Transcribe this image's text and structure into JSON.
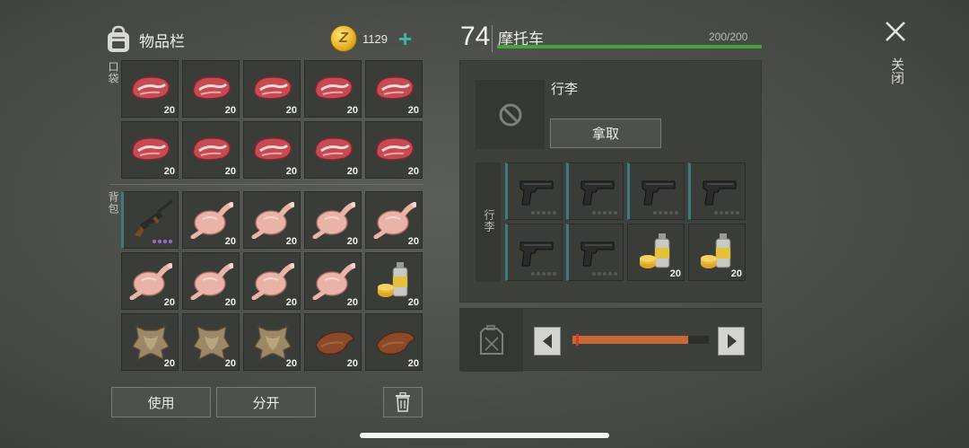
{
  "inventory": {
    "title": "物品栏",
    "coins": "1129",
    "pocket_label": "口袋",
    "backpack_label": "背包",
    "pocket_slots": [
      {
        "item": "raw-meat",
        "qty": "20"
      },
      {
        "item": "raw-meat",
        "qty": "20"
      },
      {
        "item": "raw-meat",
        "qty": "20"
      },
      {
        "item": "raw-meat",
        "qty": "20"
      },
      {
        "item": "raw-meat",
        "qty": "20"
      },
      {
        "item": "raw-meat",
        "qty": "20"
      },
      {
        "item": "raw-meat",
        "qty": "20"
      },
      {
        "item": "raw-meat",
        "qty": "20"
      },
      {
        "item": "raw-meat",
        "qty": "20"
      },
      {
        "item": "raw-meat",
        "qty": "20"
      }
    ],
    "backpack_slots": [
      {
        "item": "rifle",
        "qty": ""
      },
      {
        "item": "raw-chicken",
        "qty": "20"
      },
      {
        "item": "raw-chicken",
        "qty": "20"
      },
      {
        "item": "raw-chicken",
        "qty": "20"
      },
      {
        "item": "raw-chicken",
        "qty": "20"
      },
      {
        "item": "raw-chicken",
        "qty": "20"
      },
      {
        "item": "raw-chicken",
        "qty": "20"
      },
      {
        "item": "raw-chicken",
        "qty": "20"
      },
      {
        "item": "raw-chicken",
        "qty": "20"
      },
      {
        "item": "spray-can",
        "qty": "20"
      },
      {
        "item": "animal-hide",
        "qty": "20"
      },
      {
        "item": "animal-hide",
        "qty": "20"
      },
      {
        "item": "animal-hide",
        "qty": "20"
      },
      {
        "item": "leather",
        "qty": "20"
      },
      {
        "item": "leather",
        "qty": "20"
      }
    ],
    "use_label": "使用",
    "split_label": "分开"
  },
  "vehicle": {
    "number": "74",
    "name": "摩托车",
    "durability": "200/200",
    "durability_fraction": 1.0,
    "slot_label": "行李",
    "take_label": "拿取",
    "luggage_label": "行李",
    "luggage_slots": [
      {
        "item": "pistol",
        "qty": ""
      },
      {
        "item": "pistol",
        "qty": ""
      },
      {
        "item": "pistol",
        "qty": ""
      },
      {
        "item": "pistol",
        "qty": ""
      },
      {
        "item": "pistol",
        "qty": ""
      },
      {
        "item": "pistol",
        "qty": ""
      },
      {
        "item": "spray-can",
        "qty": "20"
      },
      {
        "item": "spray-can",
        "qty": "20"
      }
    ],
    "fuel_fraction": 0.85
  },
  "close_label": "关闭",
  "colors": {
    "accent_teal": "#3fb6a3",
    "hp_green": "#46a33b",
    "fuel_orange": "#c46a32",
    "rarity_purple": "#9b6bd8"
  }
}
